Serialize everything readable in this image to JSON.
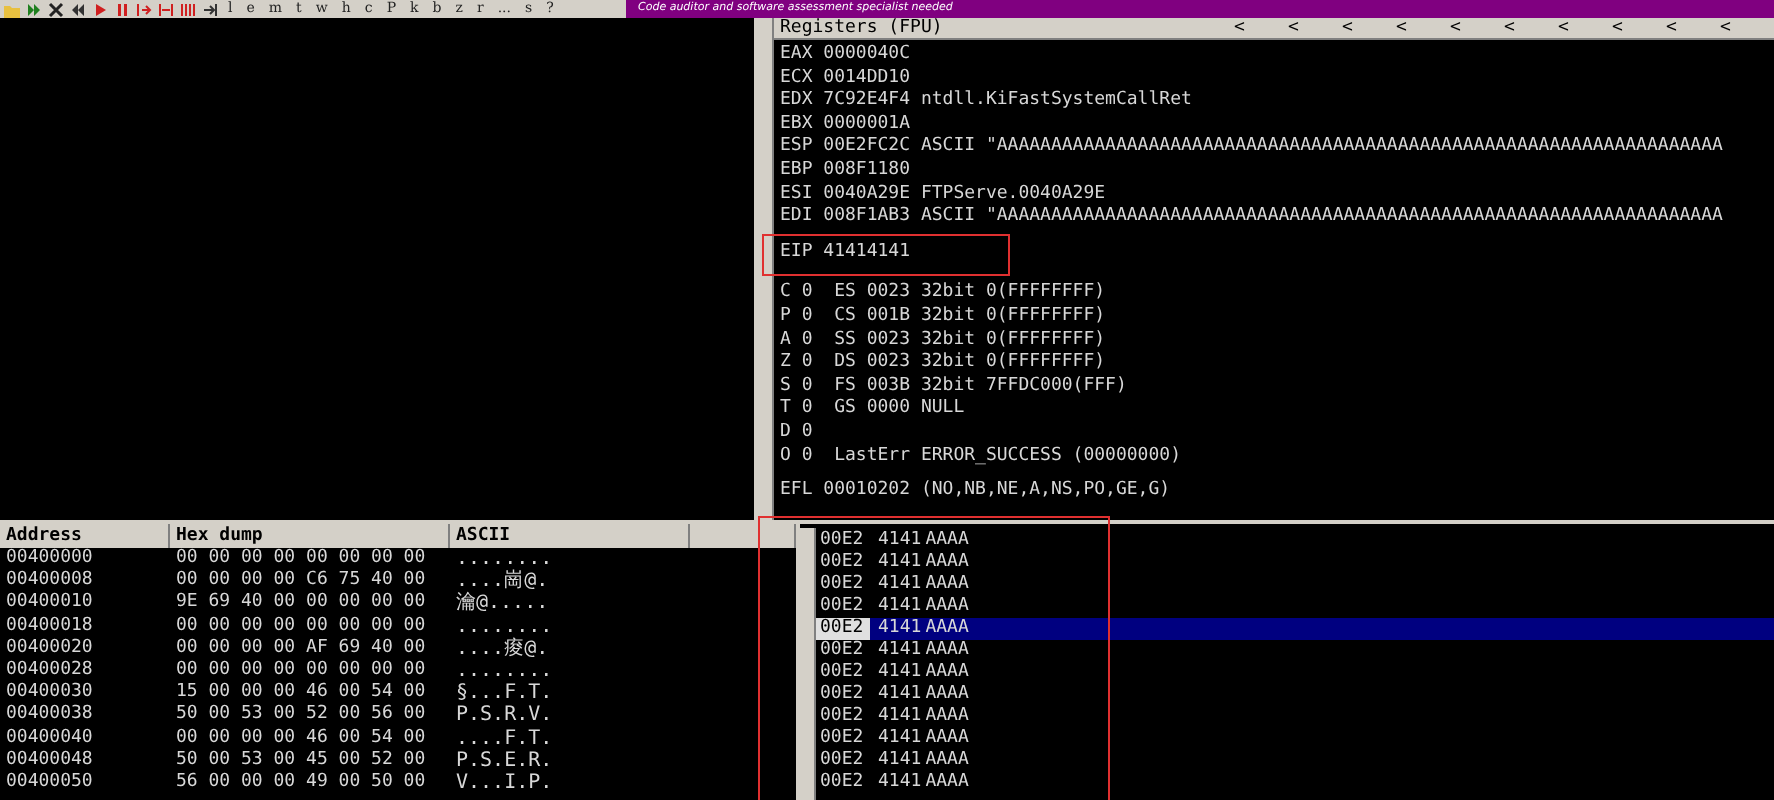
{
  "toolbar": {
    "letters": [
      "l",
      "e",
      "m",
      "t",
      "w",
      "h",
      "c",
      "P",
      "k",
      "b",
      "z",
      "r",
      "...",
      "s",
      "?"
    ],
    "banner": "Code auditor and software assessment specialist needed"
  },
  "registers": {
    "title": "Registers (FPU)",
    "arrows": [
      "<",
      "<",
      "<",
      "<",
      "<",
      "<",
      "<",
      "<",
      "<",
      "<"
    ],
    "groups": [
      [
        "EAX 0000040C",
        "ECX 0014DD10",
        "EDX 7C92E4F4 ntdll.KiFastSystemCallRet",
        "EBX 0000001A",
        "ESP 00E2FC2C ASCII \"AAAAAAAAAAAAAAAAAAAAAAAAAAAAAAAAAAAAAAAAAAAAAAAAAAAAAAAAAAAAAAAAAAA",
        "EBP 008F1180",
        "ESI 0040A29E FTPServe.0040A29E",
        "EDI 008F1AB3 ASCII \"AAAAAAAAAAAAAAAAAAAAAAAAAAAAAAAAAAAAAAAAAAAAAAAAAAAAAAAAAAAAAAAAAAA"
      ],
      [
        "EIP 41414141"
      ],
      [
        "C 0  ES 0023 32bit 0(FFFFFFFF)",
        "P 0  CS 001B 32bit 0(FFFFFFFF)",
        "A 0  SS 0023 32bit 0(FFFFFFFF)",
        "Z 0  DS 0023 32bit 0(FFFFFFFF)",
        "S 0  FS 003B 32bit 7FFDC000(FFF)",
        "T 0  GS 0000 NULL",
        "D 0",
        "O 0  LastErr ERROR_SUCCESS (00000000)"
      ],
      [
        "EFL 00010202 (NO,NB,NE,A,NS,PO,GE,G)"
      ]
    ]
  },
  "dump": {
    "columns": [
      "Address",
      "Hex dump",
      "ASCII"
    ],
    "rows": [
      [
        "00400000",
        "00 00 00 00 00 00 00 00",
        "........"
      ],
      [
        "00400008",
        "00 00 00 00 C6 75 40 00",
        "....崗@."
      ],
      [
        "00400010",
        "9E 69 40 00 00 00 00 00",
        "瀹@....."
      ],
      [
        "00400018",
        "00 00 00 00 00 00 00 00",
        "........"
      ],
      [
        "00400020",
        "00 00 00 00 AF 69 40 00",
        "....痠@."
      ],
      [
        "00400028",
        "00 00 00 00 00 00 00 00",
        "........"
      ],
      [
        "00400030",
        "15 00 00 00 46 00 54 00",
        "§...F.T."
      ],
      [
        "00400038",
        "50 00 53 00 52 00 56 00",
        "P.S.R.V."
      ],
      [
        "00400040",
        "00 00 00 00 46 00 54 00",
        "....F.T."
      ],
      [
        "00400048",
        "50 00 53 00 45 00 52 00",
        "P.S.E.R."
      ],
      [
        "00400050",
        "56 00 00 00 49 00 50 00",
        "V...I.P."
      ]
    ]
  },
  "stack": {
    "rows": [
      {
        "address": "00E2",
        "value": "4141",
        "text": "AAAA",
        "selected": false
      },
      {
        "address": "00E2",
        "value": "4141",
        "text": "AAAA",
        "selected": false
      },
      {
        "address": "00E2",
        "value": "4141",
        "text": "AAAA",
        "selected": false
      },
      {
        "address": "00E2",
        "value": "4141",
        "text": "AAAA",
        "selected": false
      },
      {
        "address": "00E2",
        "value": "4141",
        "text": "AAAA",
        "selected": true
      },
      {
        "address": "00E2",
        "value": "4141",
        "text": "AAAA",
        "selected": false
      },
      {
        "address": "00E2",
        "value": "4141",
        "text": "AAAA",
        "selected": false
      },
      {
        "address": "00E2",
        "value": "4141",
        "text": "AAAA",
        "selected": false
      },
      {
        "address": "00E2",
        "value": "4141",
        "text": "AAAA",
        "selected": false
      },
      {
        "address": "00E2",
        "value": "4141",
        "text": "AAAA",
        "selected": false
      },
      {
        "address": "00E2",
        "value": "4141",
        "text": "AAAA",
        "selected": false
      },
      {
        "address": "00E2",
        "value": "4141",
        "text": "AAAA",
        "selected": false
      }
    ]
  }
}
